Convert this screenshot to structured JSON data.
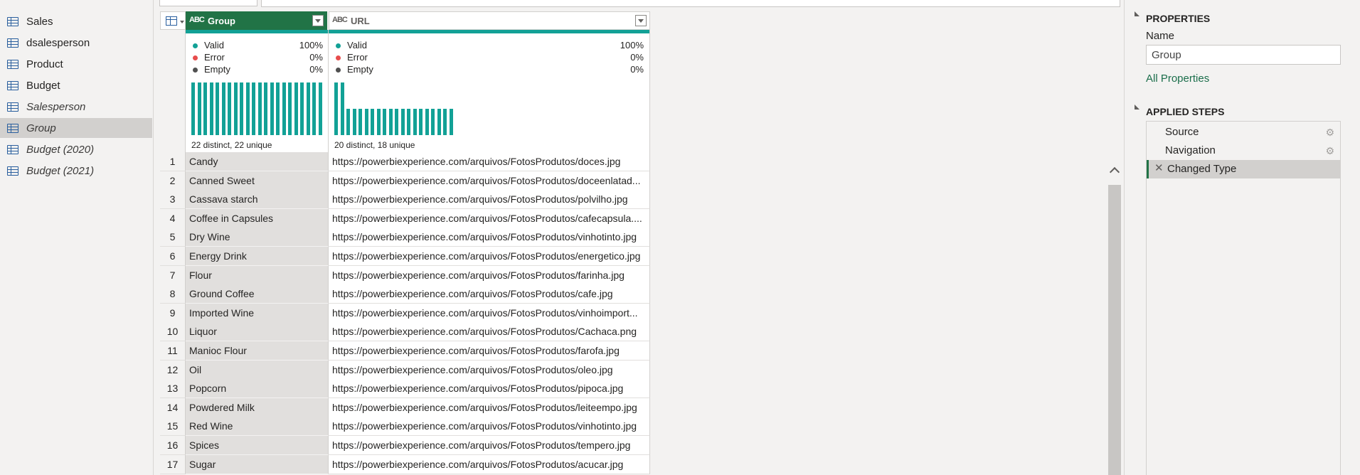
{
  "queries": [
    {
      "label": "Sales",
      "italic": false,
      "selected": false
    },
    {
      "label": "dsalesperson",
      "italic": false,
      "selected": false
    },
    {
      "label": "Product",
      "italic": false,
      "selected": false
    },
    {
      "label": "Budget",
      "italic": false,
      "selected": false
    },
    {
      "label": "Salesperson",
      "italic": true,
      "selected": false
    },
    {
      "label": "Group",
      "italic": true,
      "selected": true
    },
    {
      "label": "Budget (2020)",
      "italic": true,
      "selected": false
    },
    {
      "label": "Budget (2021)",
      "italic": true,
      "selected": false
    }
  ],
  "columns": {
    "type_icon": "ABC",
    "group": {
      "label": "Group",
      "valid_label": "Valid",
      "valid_pct": "100%",
      "error_label": "Error",
      "error_pct": "0%",
      "empty_label": "Empty",
      "empty_pct": "0%",
      "distinct": "22 distinct, 22 unique",
      "distribution": [
        1,
        1,
        1,
        1,
        1,
        1,
        1,
        1,
        1,
        1,
        1,
        1,
        1,
        1,
        1,
        1,
        1,
        1,
        1,
        1,
        1,
        1
      ]
    },
    "url": {
      "label": "URL",
      "valid_label": "Valid",
      "valid_pct": "100%",
      "error_label": "Error",
      "error_pct": "0%",
      "empty_label": "Empty",
      "empty_pct": "0%",
      "distinct": "20 distinct, 18 unique",
      "distribution": [
        2,
        2,
        1,
        1,
        1,
        1,
        1,
        1,
        1,
        1,
        1,
        1,
        1,
        1,
        1,
        1,
        1,
        1,
        1,
        1
      ]
    }
  },
  "rows": [
    {
      "n": "1",
      "group": "Candy",
      "url": "https://powerbiexperience.com/arquivos/FotosProdutos/doces.jpg"
    },
    {
      "n": "2",
      "group": "Canned Sweet",
      "url": "https://powerbiexperience.com/arquivos/FotosProdutos/doceenlatad..."
    },
    {
      "n": "3",
      "group": "Cassava starch",
      "url": "https://powerbiexperience.com/arquivos/FotosProdutos/polvilho.jpg"
    },
    {
      "n": "4",
      "group": "Coffee in Capsules",
      "url": "https://powerbiexperience.com/arquivos/FotosProdutos/cafecapsula...."
    },
    {
      "n": "5",
      "group": "Dry Wine",
      "url": "https://powerbiexperience.com/arquivos/FotosProdutos/vinhotinto.jpg"
    },
    {
      "n": "6",
      "group": "Energy Drink",
      "url": "https://powerbiexperience.com/arquivos/FotosProdutos/energetico.jpg"
    },
    {
      "n": "7",
      "group": "Flour",
      "url": "https://powerbiexperience.com/arquivos/FotosProdutos/farinha.jpg"
    },
    {
      "n": "8",
      "group": "Ground Coffee",
      "url": "https://powerbiexperience.com/arquivos/FotosProdutos/cafe.jpg"
    },
    {
      "n": "9",
      "group": "Imported Wine",
      "url": "https://powerbiexperience.com/arquivos/FotosProdutos/vinhoimport..."
    },
    {
      "n": "10",
      "group": "Liquor",
      "url": "https://powerbiexperience.com/arquivos/FotosProdutos/Cachaca.png"
    },
    {
      "n": "11",
      "group": "Manioc Flour",
      "url": "https://powerbiexperience.com/arquivos/FotosProdutos/farofa.jpg"
    },
    {
      "n": "12",
      "group": "Oil",
      "url": "https://powerbiexperience.com/arquivos/FotosProdutos/oleo.jpg"
    },
    {
      "n": "13",
      "group": "Popcorn",
      "url": "https://powerbiexperience.com/arquivos/FotosProdutos/pipoca.jpg"
    },
    {
      "n": "14",
      "group": "Powdered Milk",
      "url": "https://powerbiexperience.com/arquivos/FotosProdutos/leiteempo.jpg"
    },
    {
      "n": "15",
      "group": "Red Wine",
      "url": "https://powerbiexperience.com/arquivos/FotosProdutos/vinhotinto.jpg"
    },
    {
      "n": "16",
      "group": "Spices",
      "url": "https://powerbiexperience.com/arquivos/FotosProdutos/tempero.jpg"
    },
    {
      "n": "17",
      "group": "Sugar",
      "url": "https://powerbiexperience.com/arquivos/FotosProdutos/acucar.jpg"
    }
  ],
  "properties": {
    "title": "PROPERTIES",
    "name_label": "Name",
    "name_value": "Group",
    "all_properties": "All Properties"
  },
  "applied_steps": {
    "title": "APPLIED STEPS",
    "steps": [
      {
        "label": "Source",
        "gear": true,
        "selected": false
      },
      {
        "label": "Navigation",
        "gear": true,
        "selected": false
      },
      {
        "label": "Changed Type",
        "gear": false,
        "selected": true
      }
    ]
  },
  "colors": {
    "valid": "#12a196",
    "error": "#e74c4c",
    "empty": "#505050",
    "selected_header": "#217346"
  }
}
